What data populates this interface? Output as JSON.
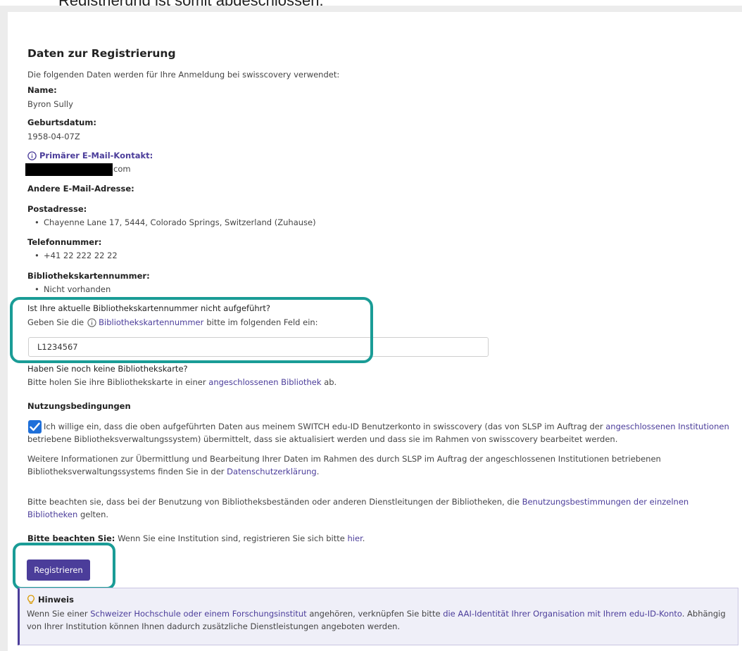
{
  "caption": "Registrierung ist somit abgeschlossen.",
  "heading": "Daten zur Registrierung",
  "intro": "Die folgenden Daten werden für Ihre Anmeldung bei swisscovery verwendet:",
  "name": {
    "label": "Name:",
    "value": "Byron Sully"
  },
  "birth": {
    "label": "Geburtsdatum:",
    "value": "1958-04-07Z"
  },
  "email": {
    "label": "Primärer E-Mail-Kontakt:",
    "value_suffix": "com"
  },
  "other_email": {
    "label": "Andere E-Mail-Adresse:"
  },
  "address": {
    "label": "Postadresse:",
    "items": [
      "Chayenne Lane 17, 5444, Colorado Springs, Switzerland (Zuhause)"
    ]
  },
  "phone": {
    "label": "Telefonnummer:",
    "items": [
      "+41 22 222 22 22"
    ]
  },
  "card": {
    "label": "Bibliothekskartennummer:",
    "items": [
      "Nicht vorhanden"
    ]
  },
  "card_missing": {
    "question": "Ist Ihre aktuelle Bibliothekskartennummer nicht aufgeführt?",
    "instruction_pre": "Geben Sie die",
    "instruction_link": "Bibliothekskartennummer",
    "instruction_post": "bitte im folgenden Feld ein:",
    "input_value": "L1234567"
  },
  "no_card": {
    "question": "Haben Sie noch keine Bibliothekskarte?",
    "text_pre": "Bitte holen Sie ihre Bibliothekskarte in einer",
    "text_link": "angeschlossenen Bibliothek",
    "text_post": "ab."
  },
  "terms": {
    "heading": "Nutzungsbedingungen",
    "consent_part1": "Ich willige ein, dass die oben aufgeführten Daten aus meinem SWITCH edu-ID Benutzerkonto in swisscovery (das von SLSP im Auftrag der",
    "consent_link": "angeschlossenen Institutionen",
    "consent_part2": "betriebene Bibliotheksverwaltungssystem) übermittelt, dass sie aktualisiert werden und dass sie im Rahmen von swisscovery bearbeitet werden.",
    "info_part1": "Weitere Informationen zur Übermittlung und Bearbeitung Ihrer Daten im Rahmen des durch SLSP im Auftrag der angeschlossenen Institutionen betriebenen Bibliotheksverwaltungssystems finden Sie in der",
    "info_link": "Datenschutzerklärung",
    "info_end": ".",
    "usage_part1": "Bitte beachten sie, dass bei der Benutzung von Bibliotheksbeständen oder anderen Dienstleitungen der Bibliotheken, die",
    "usage_link": "Benutzungsbestimmungen der einzelnen Bibliotheken",
    "usage_part2": "gelten."
  },
  "institution": {
    "bold": "Bitte beachten Sie:",
    "text": "Wenn Sie eine Institution sind, registrieren Sie sich bitte",
    "link": "hier",
    "end": "."
  },
  "register_button": "Registrieren",
  "hint": {
    "title": "Hinweis",
    "part1": "Wenn Sie einer",
    "link1": "Schweizer Hochschule oder einem Forschungsinstitut",
    "part2": "angehören, verknüpfen Sie bitte",
    "link2": "die AAI-Identität Ihrer Organisation mit Ihrem edu-ID-Konto",
    "part3": ". Abhängig von Ihrer Institution können Ihnen dadurch zusätzliche Dienstleistungen angeboten werden."
  },
  "colors": {
    "accent": "#4b3d9a",
    "highlight": "#1a9c96",
    "checkbox": "#1e6fd9"
  }
}
